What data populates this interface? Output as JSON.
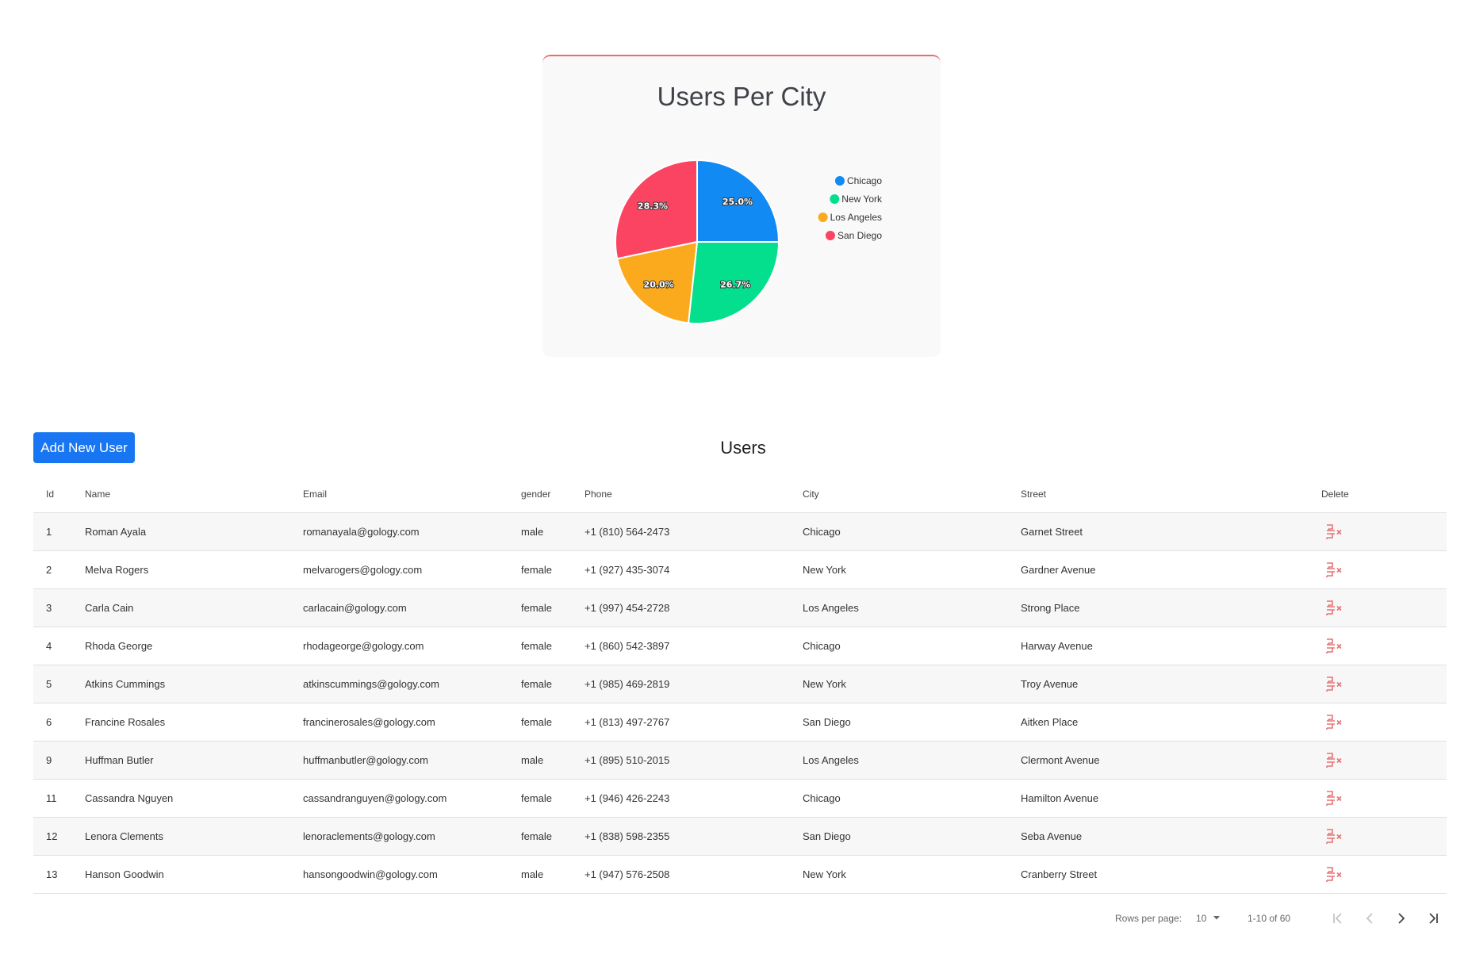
{
  "chart_data": {
    "type": "pie",
    "title": "Users Per City",
    "series": [
      {
        "name": "Chicago",
        "value": 25.0,
        "label": "25.0%",
        "color": "#118af4"
      },
      {
        "name": "New York",
        "value": 26.7,
        "label": "26.7%",
        "color": "#04df8e"
      },
      {
        "name": "Los Angeles",
        "value": 20.0,
        "label": "20.0%",
        "color": "#faaa1c"
      },
      {
        "name": "San Diego",
        "value": 28.3,
        "label": "28.3%",
        "color": "#fb4462"
      }
    ],
    "legend_position": "right"
  },
  "users_section": {
    "add_button_label": "Add New User",
    "title": "Users",
    "columns": [
      "Id",
      "Name",
      "Email",
      "gender",
      "Phone",
      "City",
      "Street",
      "Delete"
    ],
    "rows": [
      {
        "id": "1",
        "name": "Roman Ayala",
        "email": "romanayala@gology.com",
        "gender": "male",
        "phone": "+1 (810) 564-2473",
        "city": "Chicago",
        "street": "Garnet Street"
      },
      {
        "id": "2",
        "name": "Melva Rogers",
        "email": "melvarogers@gology.com",
        "gender": "female",
        "phone": "+1 (927) 435-3074",
        "city": "New York",
        "street": "Gardner Avenue"
      },
      {
        "id": "3",
        "name": "Carla Cain",
        "email": "carlacain@gology.com",
        "gender": "female",
        "phone": "+1 (997) 454-2728",
        "city": "Los Angeles",
        "street": "Strong Place"
      },
      {
        "id": "4",
        "name": "Rhoda George",
        "email": "rhodageorge@gology.com",
        "gender": "female",
        "phone": "+1 (860) 542-3897",
        "city": "Chicago",
        "street": "Harway Avenue"
      },
      {
        "id": "5",
        "name": "Atkins Cummings",
        "email": "atkinscummings@gology.com",
        "gender": "female",
        "phone": "+1 (985) 469-2819",
        "city": "New York",
        "street": "Troy Avenue"
      },
      {
        "id": "6",
        "name": "Francine Rosales",
        "email": "francinerosales@gology.com",
        "gender": "female",
        "phone": "+1 (813) 497-2767",
        "city": "San Diego",
        "street": "Aitken Place"
      },
      {
        "id": "9",
        "name": "Huffman Butler",
        "email": "huffmanbutler@gology.com",
        "gender": "male",
        "phone": "+1 (895) 510-2015",
        "city": "Los Angeles",
        "street": "Clermont Avenue"
      },
      {
        "id": "11",
        "name": "Cassandra Nguyen",
        "email": "cassandranguyen@gology.com",
        "gender": "female",
        "phone": "+1 (946) 426-2243",
        "city": "Chicago",
        "street": "Hamilton Avenue"
      },
      {
        "id": "12",
        "name": "Lenora Clements",
        "email": "lenoraclements@gology.com",
        "gender": "female",
        "phone": "+1 (838) 598-2355",
        "city": "San Diego",
        "street": "Seba Avenue"
      },
      {
        "id": "13",
        "name": "Hanson Goodwin",
        "email": "hansongoodwin@gology.com",
        "gender": "male",
        "phone": "+1 (947) 576-2508",
        "city": "New York",
        "street": "Cranberry Street"
      }
    ],
    "delete_icon": "remove-row-icon",
    "delete_color": "#e57373"
  },
  "pagination": {
    "rows_per_page_label": "Rows per page:",
    "rows_per_page_value": "10",
    "range_text": "1-10 of 60",
    "icons": [
      "first-page-icon",
      "previous-page-icon",
      "next-page-icon",
      "last-page-icon"
    ]
  }
}
